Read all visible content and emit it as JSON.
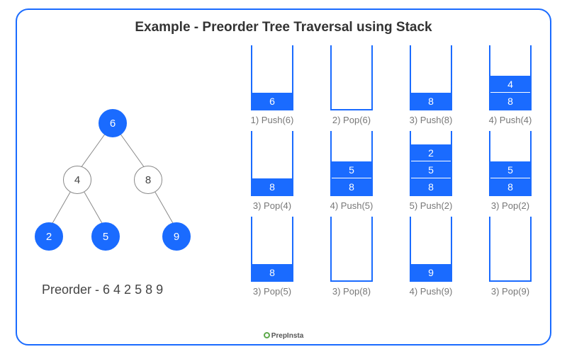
{
  "title": "Example - Preorder Tree Traversal using Stack",
  "tree": {
    "nodes": {
      "root": {
        "value": "6",
        "filled": true
      },
      "l": {
        "value": "4",
        "filled": false
      },
      "r": {
        "value": "8",
        "filled": false
      },
      "ll": {
        "value": "2",
        "filled": true
      },
      "lr": {
        "value": "5",
        "filled": true
      },
      "rr": {
        "value": "9",
        "filled": true
      }
    }
  },
  "preorder_label": "Preorder - 6 4 2 5 8 9",
  "stacks": [
    {
      "contents": [
        "6"
      ],
      "caption": "1) Push(6)"
    },
    {
      "contents": [],
      "caption": "2) Pop(6)"
    },
    {
      "contents": [
        "8"
      ],
      "caption": "3) Push(8)"
    },
    {
      "contents": [
        "8",
        "4"
      ],
      "caption": "4) Push(4)"
    },
    {
      "contents": [
        "8"
      ],
      "caption": "3) Pop(4)"
    },
    {
      "contents": [
        "8",
        "5"
      ],
      "caption": "4) Push(5)"
    },
    {
      "contents": [
        "8",
        "5",
        "2"
      ],
      "caption": "5) Push(2)"
    },
    {
      "contents": [
        "8",
        "5"
      ],
      "caption": "3)  Pop(2)"
    },
    {
      "contents": [
        "8"
      ],
      "caption": "3) Pop(5)"
    },
    {
      "contents": [],
      "caption": "3) Pop(8)"
    },
    {
      "contents": [
        "9"
      ],
      "caption": "4) Push(9)"
    },
    {
      "contents": [],
      "caption": "3) Pop(9)"
    }
  ],
  "footer": "PrepInsta"
}
